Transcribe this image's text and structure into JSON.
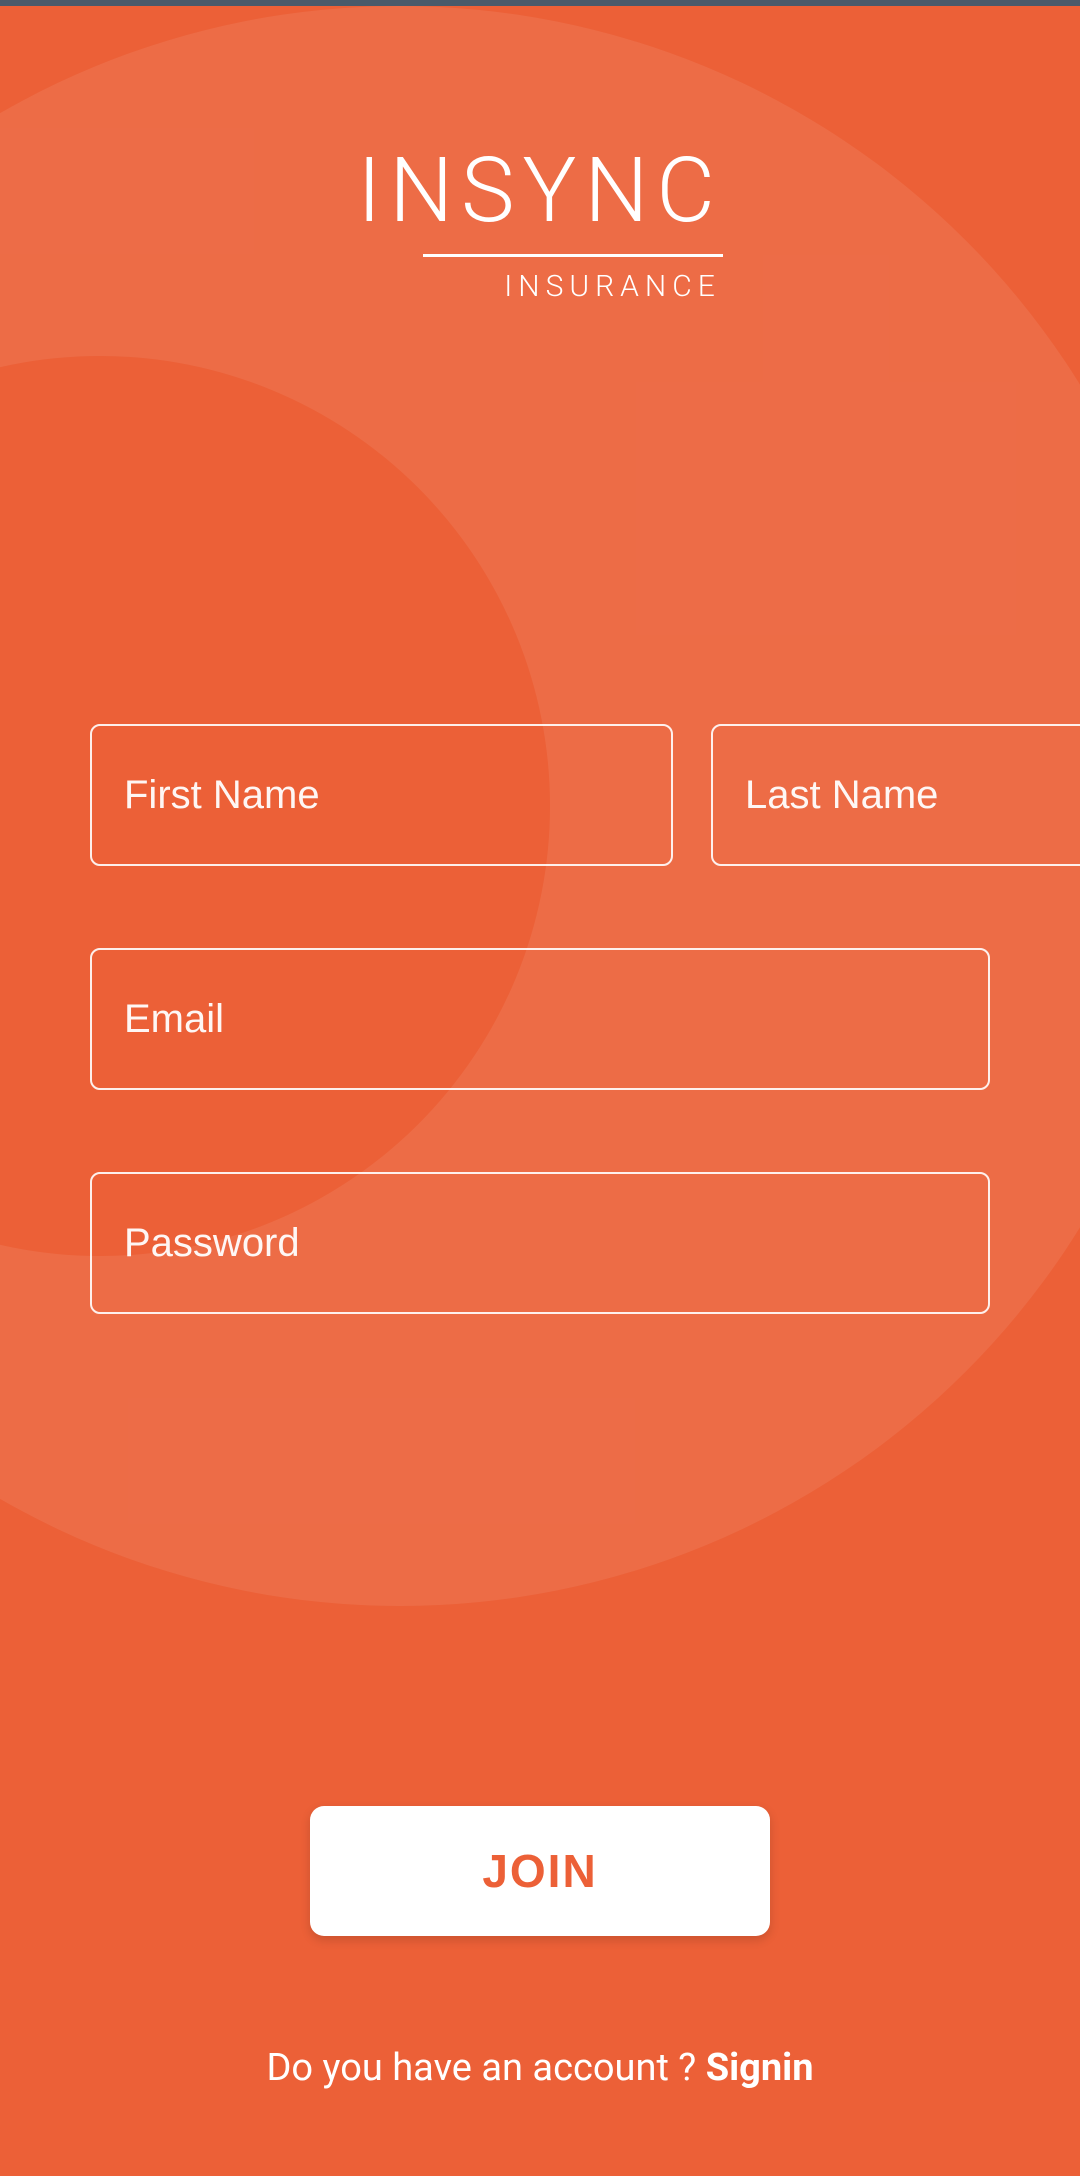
{
  "logo": {
    "main": "INSYNC",
    "sub": "INSURANCE"
  },
  "form": {
    "first_name_placeholder": "First Name",
    "last_name_placeholder": "Last Name",
    "email_placeholder": "Email",
    "password_placeholder": "Password"
  },
  "join_button": "JOIN",
  "footer": {
    "prompt": "Do you have an account ? ",
    "signin": "Signin"
  }
}
